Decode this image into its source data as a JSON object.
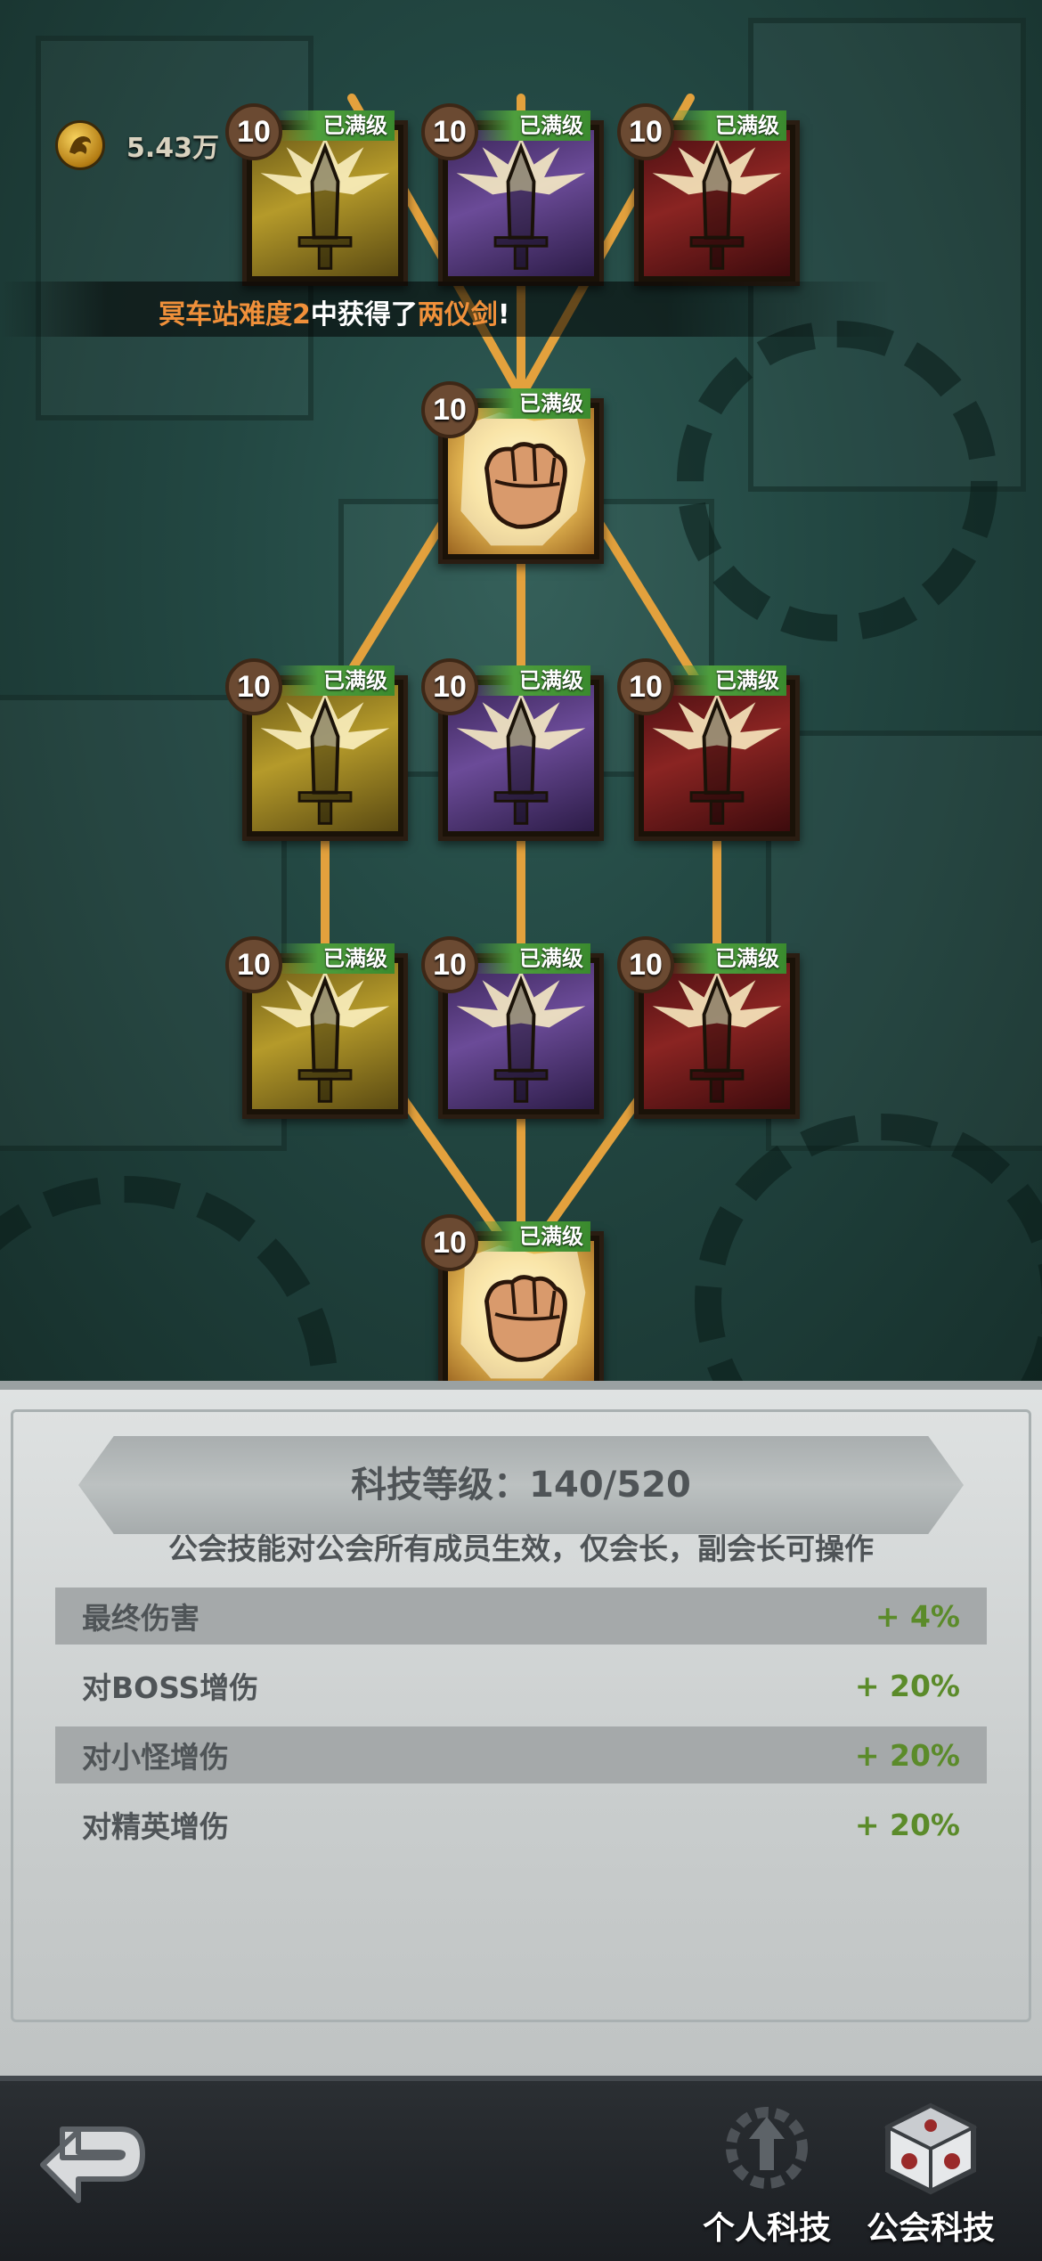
{
  "currency": {
    "value": "5.43万"
  },
  "notification": {
    "prefix": "冥车站难度2",
    "middle": "中获得了",
    "item": "两仪剑",
    "suffix": "!"
  },
  "tree": {
    "nodes": [
      {
        "level": "10",
        "status": "已满级",
        "icon": "gold-sword-icon"
      },
      {
        "level": "10",
        "status": "已满级",
        "icon": "purple-sword-icon"
      },
      {
        "level": "10",
        "status": "已满级",
        "icon": "red-sword-icon"
      },
      {
        "level": "10",
        "status": "已满级",
        "icon": "fist-icon"
      },
      {
        "level": "10",
        "status": "已满级",
        "icon": "gold-sword-icon"
      },
      {
        "level": "10",
        "status": "已满级",
        "icon": "purple-sword-icon"
      },
      {
        "level": "10",
        "status": "已满级",
        "icon": "red-sword-icon"
      },
      {
        "level": "10",
        "status": "已满级",
        "icon": "gold-sword-icon"
      },
      {
        "level": "10",
        "status": "已满级",
        "icon": "purple-sword-icon"
      },
      {
        "level": "10",
        "status": "已满级",
        "icon": "red-sword-icon"
      },
      {
        "level": "10",
        "status": "已满级",
        "icon": "fist-icon"
      }
    ]
  },
  "info": {
    "tech_level": "科技等级：140/520",
    "description": "公会技能对公会所有成员生效，仅会长，副会长可操作",
    "stats": [
      {
        "name": "最终伤害",
        "value": "+ 4%"
      },
      {
        "name": "对BOSS增伤",
        "value": "+ 20%"
      },
      {
        "name": "对小怪增伤",
        "value": "+ 20%"
      },
      {
        "name": "对精英增伤",
        "value": "+ 20%"
      }
    ]
  },
  "bottom_bar": {
    "tabs": [
      {
        "label": "个人科技",
        "icon": "personal-tech-icon"
      },
      {
        "label": "公会科技",
        "icon": "guild-tech-icon",
        "active": true
      }
    ]
  },
  "colors": {
    "link": "#e3a13d",
    "max_badge": "#4e9e3d",
    "stat_value": "#5b8b2a"
  }
}
